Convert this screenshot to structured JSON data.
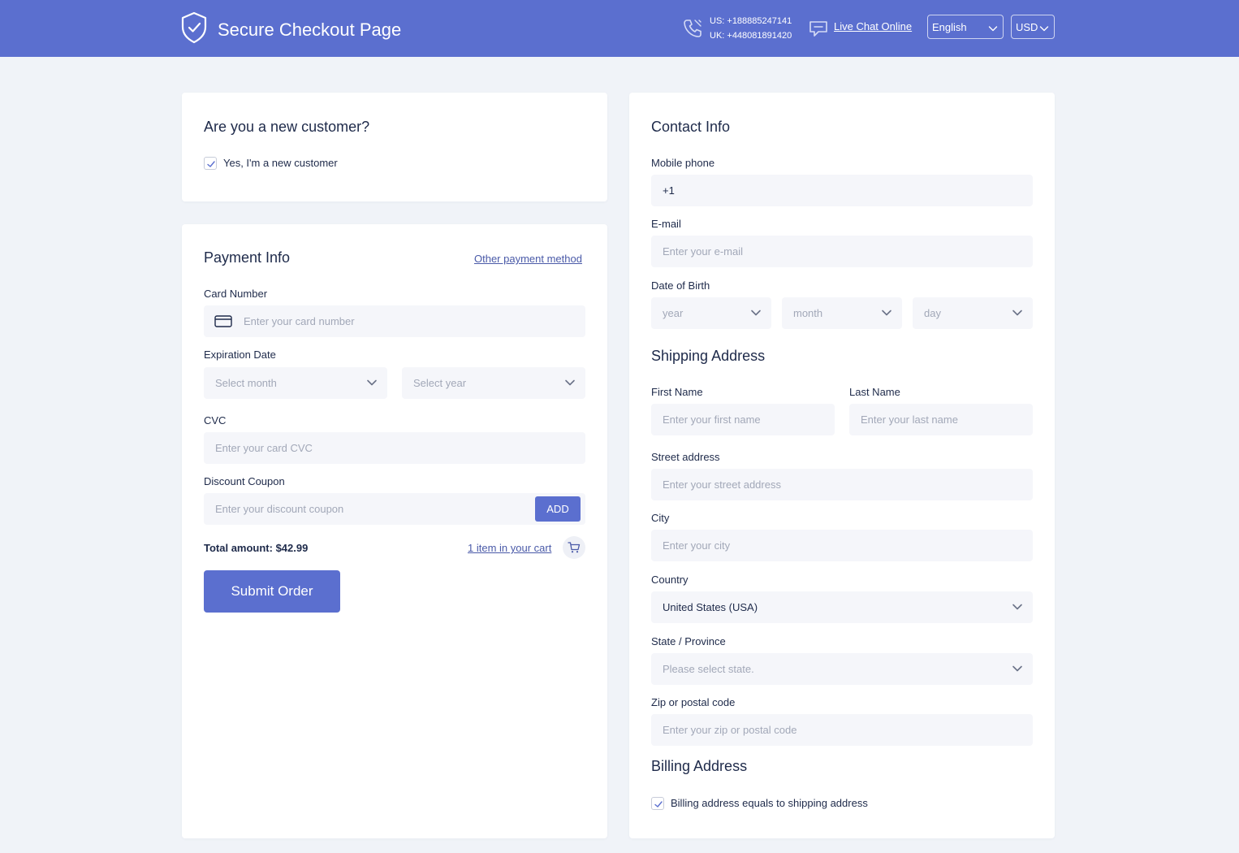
{
  "header": {
    "title": "Secure Checkout Page",
    "phone_us": "US: +188885247141",
    "phone_uk": "UK: +448081891420",
    "chat_label": "Live Chat Online",
    "language": "English",
    "currency": "USD",
    "bg_color": "#5b6fcf"
  },
  "new_customer": {
    "title": "Are you a new customer?",
    "checkbox_label": "Yes, I'm a new customer",
    "checked": true
  },
  "payment": {
    "title": "Payment Info",
    "other_method_link": "Other payment method",
    "card_number_label": "Card Number",
    "card_number_placeholder": "Enter your card number",
    "expiration_label": "Expiration Date",
    "month_placeholder": "Select month",
    "year_placeholder": "Select year",
    "cvc_label": "CVC",
    "cvc_placeholder": "Enter your card CVC",
    "coupon_label": "Discount Coupon",
    "coupon_placeholder": "Enter your discount coupon",
    "add_button": "ADD",
    "total": "Total amount: $42.99",
    "cart_link": "1 item in your cart",
    "submit_button": "Submit Order"
  },
  "contact": {
    "title": "Contact Info",
    "mobile_label": "Mobile phone",
    "mobile_value": "+1",
    "email_label": "E-mail",
    "email_placeholder": "Enter your e-mail",
    "dob_label": "Date of Birth",
    "dob_year": "year",
    "dob_month": "month",
    "dob_day": "day"
  },
  "shipping": {
    "title": "Shipping Address",
    "first_name_label": "First Name",
    "first_name_placeholder": "Enter your first name",
    "last_name_label": "Last Name",
    "last_name_placeholder": "Enter your last name",
    "street_label": "Street address",
    "street_placeholder": "Enter your street address",
    "city_label": "City",
    "city_placeholder": "Enter your city",
    "country_label": "Country",
    "country_value": "United States (USA)",
    "state_label": "State / Province",
    "state_placeholder": "Please select state.",
    "zip_label": "Zip or postal code",
    "zip_placeholder": "Enter your zip or postal code"
  },
  "billing": {
    "title": "Billing Address",
    "checkbox_label": "Billing address equals to shipping address",
    "checked": true
  },
  "icons": {
    "brand": "shield-check-icon",
    "phone": "phone-icon",
    "chat": "chat-icon",
    "card": "credit-card-icon",
    "cart": "cart-icon",
    "chevron": "chevron-down-icon"
  },
  "colors": {
    "accent": "#5b6fcf",
    "page_bg": "#f0f3f8",
    "field_bg": "#f5f6fa"
  }
}
